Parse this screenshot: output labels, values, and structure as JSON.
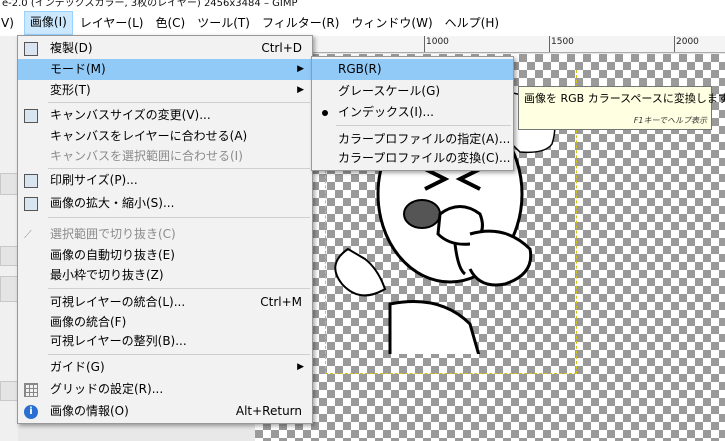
{
  "window": {
    "title": "e-2.0 (インデックスカラー, 3枚のレイヤー) 2456x3484 – GIMP"
  },
  "menubar": {
    "edge_label": "V)",
    "items": [
      {
        "label": "画像(I)"
      },
      {
        "label": "レイヤー(L)"
      },
      {
        "label": "色(C)"
      },
      {
        "label": "ツール(T)"
      },
      {
        "label": "フィルター(R)"
      },
      {
        "label": "ウィンドウ(W)"
      },
      {
        "label": "ヘルプ(H)"
      }
    ]
  },
  "ruler": {
    "ticks": [
      "1000",
      "1500",
      "2000"
    ]
  },
  "image_menu": {
    "items": [
      {
        "label": "複製(D)",
        "shortcut": "Ctrl+D",
        "icon": "duplicate-icon"
      },
      {
        "label": "モード(M)",
        "submenu": true
      },
      {
        "label": "変形(T)",
        "submenu": true
      },
      {
        "label": "キャンバスサイズの変更(V)...",
        "icon": "canvas-size-icon"
      },
      {
        "label": "キャンバスをレイヤーに合わせる(A)"
      },
      {
        "label": "キャンバスを選択範囲に合わせる(I)",
        "disabled": true
      },
      {
        "label": "印刷サイズ(P)...",
        "icon": "print-size-icon"
      },
      {
        "label": "画像の拡大・縮小(S)...",
        "icon": "scale-image-icon"
      },
      {
        "label": "選択範囲で切り抜き(C)",
        "disabled": true,
        "icon": "crop-icon"
      },
      {
        "label": "画像の自動切り抜き(E)"
      },
      {
        "label": "最小枠で切り抜き(Z)"
      },
      {
        "label": "可視レイヤーの統合(L)...",
        "shortcut": "Ctrl+M"
      },
      {
        "label": "画像の統合(F)"
      },
      {
        "label": "可視レイヤーの整列(B)..."
      },
      {
        "label": "ガイド(G)",
        "submenu": true
      },
      {
        "label": "グリッドの設定(R)...",
        "icon": "grid-icon"
      },
      {
        "label": "画像の情報(O)",
        "shortcut": "Alt+Return",
        "icon": "info-icon"
      }
    ]
  },
  "mode_submenu": {
    "items": [
      {
        "label": "RGB(R)"
      },
      {
        "label": "グレースケール(G)"
      },
      {
        "label": "インデックス(I)...",
        "selected": true
      },
      {
        "label": "カラープロファイルの指定(A)..."
      },
      {
        "label": "カラープロファイルの変換(C)..."
      }
    ]
  },
  "tooltip": {
    "text": "画像を RGB カラースペースに変換します",
    "help": "F1キーでヘルプ表示"
  },
  "colors": {
    "menu_highlight": "#91c9f7",
    "menubar_active": "#cce8ff",
    "tooltip_bg": "#ffffe1",
    "guide": "#d4c21a"
  }
}
